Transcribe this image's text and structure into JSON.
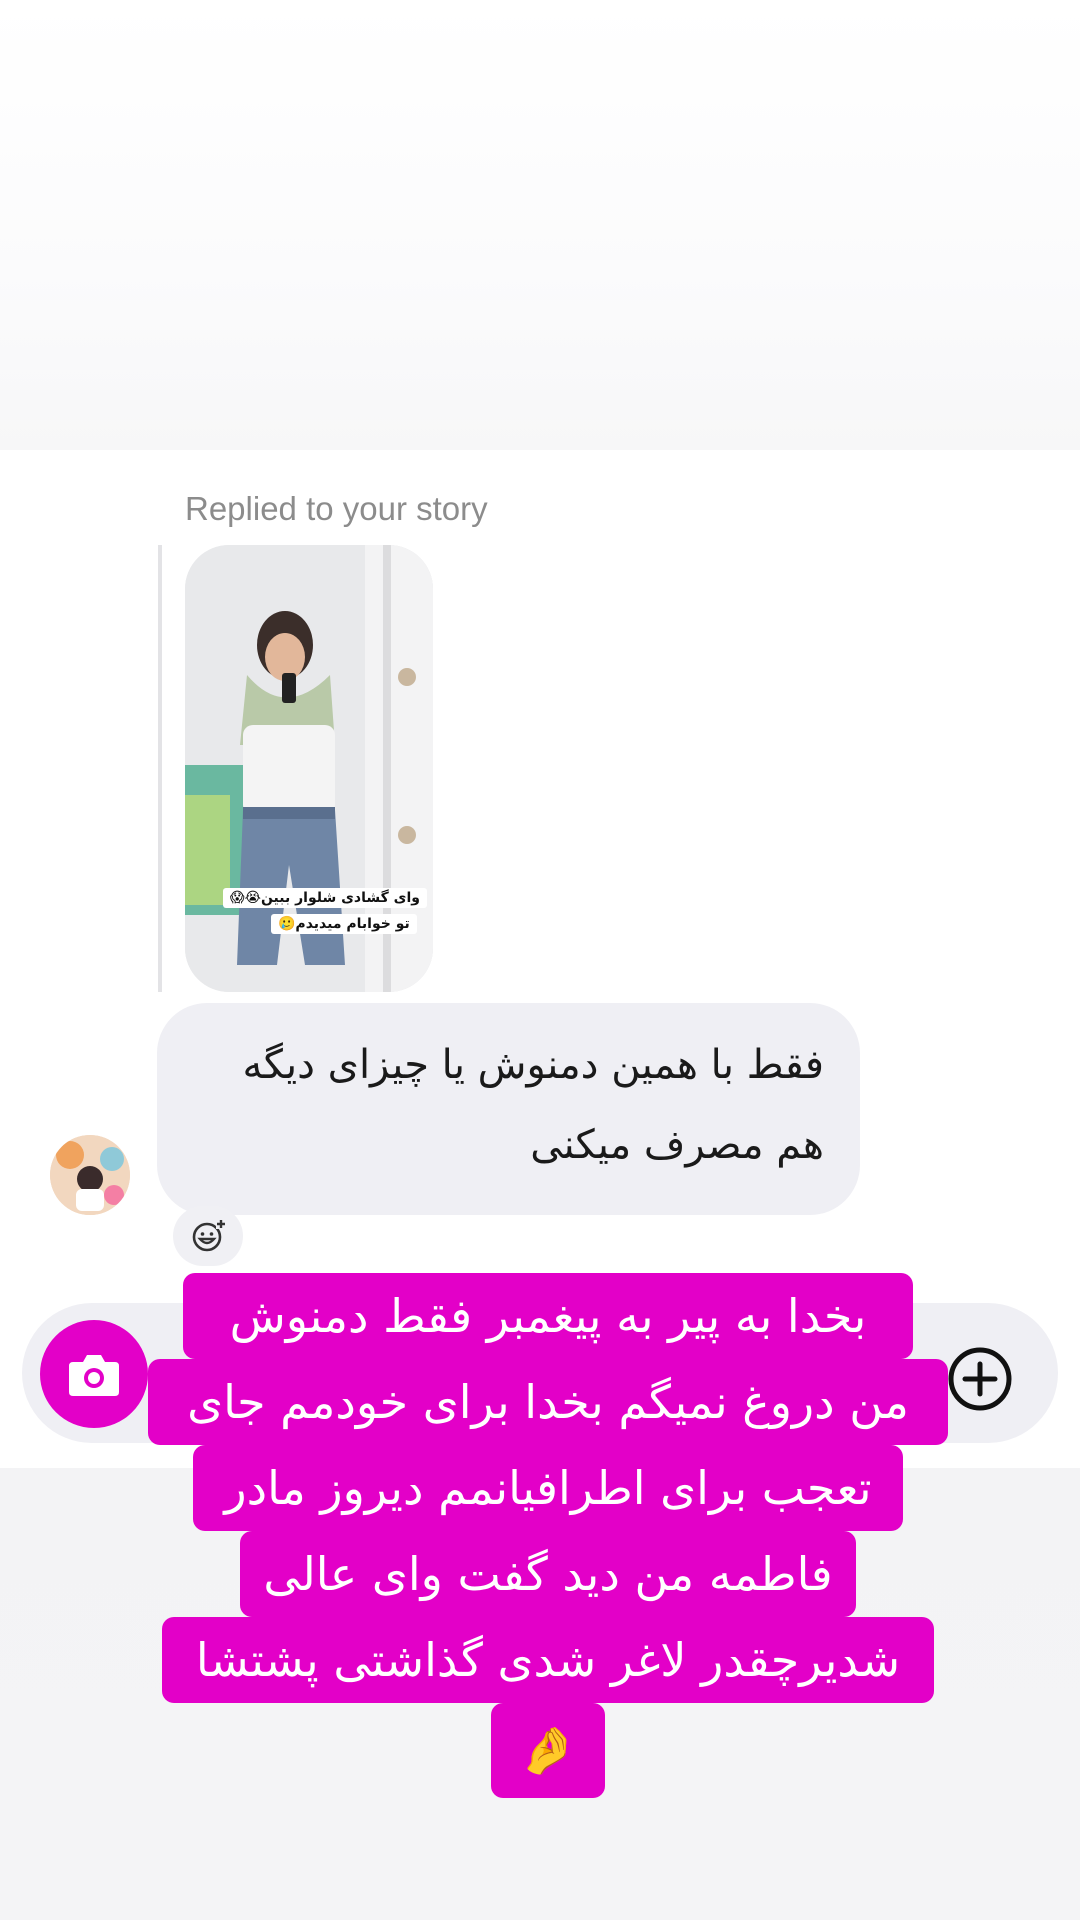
{
  "story_reply": {
    "label": "Replied to your story",
    "story_captions": [
      "وای گشادی شلوار ببین😭😱",
      "تو خوابام میدیدم🥲"
    ]
  },
  "message": {
    "text": "فقط با همین دمنوش یا چیزای دیگه هم مصرف میکنی"
  },
  "composer": {
    "camera_icon": "camera-icon",
    "add_icon": "plus-circle-icon",
    "react_icon": "add-reaction-icon"
  },
  "overlay": {
    "lines": [
      "بخدا به پیر به پیغمبر فقط دمنوش",
      "من دروغ نمیگم بخدا برای خودمم جای",
      "تعجب برای اطرافیانمم دیروز مادر",
      "فاطمه من دید گفت وای عالی",
      "شدیرچقدر لاغر شدی گذاشتی پشتشا",
      "🤌"
    ]
  },
  "colors": {
    "accent": "#e300c8",
    "bubble": "#efeff4",
    "label_gray": "#8c8c8c"
  }
}
